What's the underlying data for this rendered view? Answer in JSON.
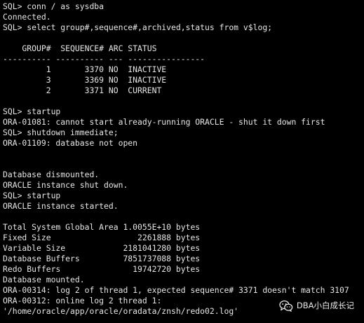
{
  "terminal": {
    "lines": [
      "SQL> conn / as sysdba",
      "Connected.",
      "SQL> select group#,sequence#,archived,status from v$log;",
      "",
      "    GROUP#  SEQUENCE# ARC STATUS",
      "---------- ---------- --- ----------------",
      "         1       3370 NO  INACTIVE",
      "         3       3369 NO  INACTIVE",
      "         2       3371 NO  CURRENT",
      "",
      "SQL> startup",
      "ORA-01081: cannot start already-running ORACLE - shut it down first",
      "SQL> shutdown immediate;",
      "ORA-01109: database not open",
      "",
      "",
      "Database dismounted.",
      "ORACLE instance shut down.",
      "SQL> startup",
      "ORACLE instance started.",
      "",
      "Total System Global Area 1.0055E+10 bytes",
      "Fixed Size                  2261888 bytes",
      "Variable Size            2181041280 bytes",
      "Database Buffers         7851737088 bytes",
      "Redo Buffers               19742720 bytes",
      "Database mounted.",
      "ORA-00314: log 2 of thread 1, expected sequence# 3371 doesn't match 3107",
      "ORA-00312: online log 2 thread 1:",
      "'/home/oracle/app/oracle/oradata/znsh/redo02.log'"
    ]
  },
  "watermark": {
    "icon": "wechat-icon",
    "text": "DBA小白成长记"
  }
}
